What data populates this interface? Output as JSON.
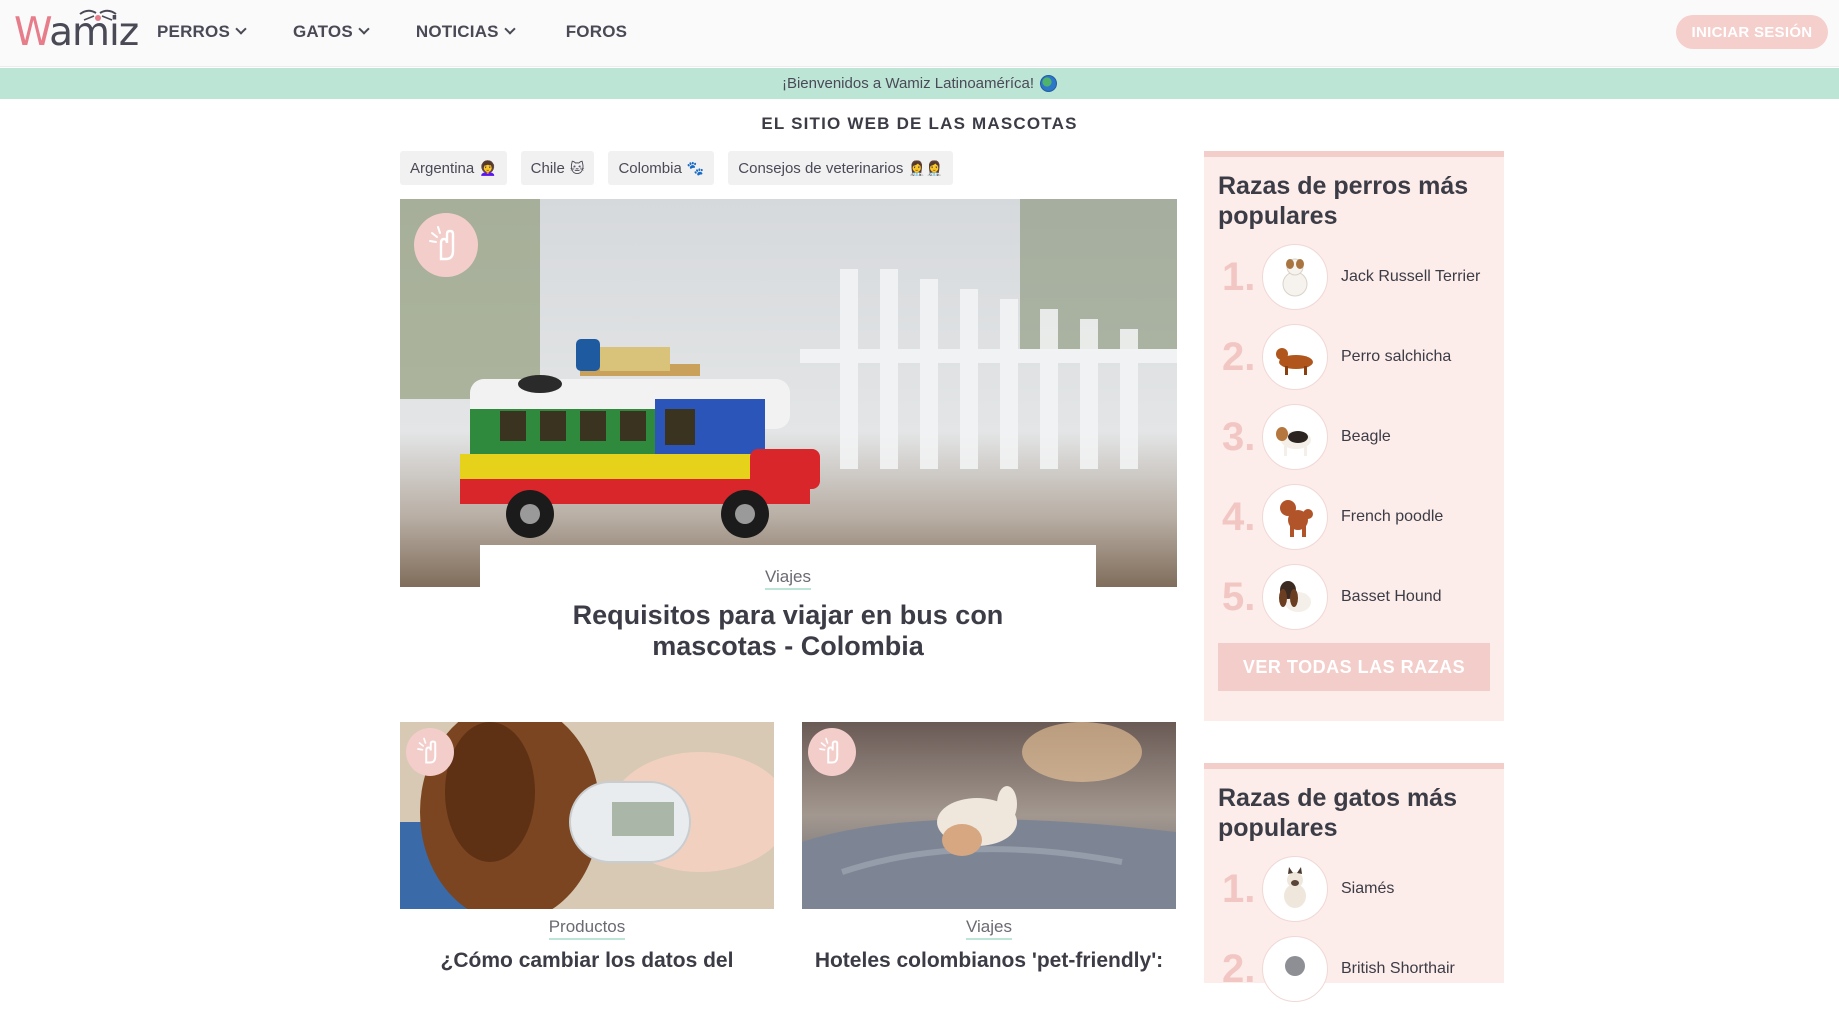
{
  "header": {
    "logo_text_w": "W",
    "logo_text_rest": "amiz",
    "nav": [
      {
        "label": "PERROS",
        "has_dropdown": true
      },
      {
        "label": "GATOS",
        "has_dropdown": true
      },
      {
        "label": "NOTICIAS",
        "has_dropdown": true
      },
      {
        "label": "FOROS",
        "has_dropdown": false
      }
    ],
    "login_label": "INICIAR SESIÓN"
  },
  "welcome_bar": {
    "text": "¡Bienvenidos a Wamiz Latinoaméríca!",
    "icon": "globe-icon"
  },
  "tagline": "EL SITIO WEB DE LAS MASCOTAS",
  "chips": [
    {
      "label": "Argentina",
      "emoji": "👩‍🦱"
    },
    {
      "label": "Chile",
      "emoji": "🐱"
    },
    {
      "label": "Colombia",
      "emoji": "🐾"
    },
    {
      "label": "Consejos de veterinarios",
      "emoji": "👩‍⚕️👩‍⚕️"
    }
  ],
  "hero": {
    "category": "Viajes",
    "title_line1": "Requisitos para viajar en bus con",
    "title_line2": "mascotas - Colombia",
    "badge_icon": "advice-hand-icon"
  },
  "cards": [
    {
      "category": "Productos",
      "title": "¿Cómo cambiar los datos del"
    },
    {
      "category": "Viajes",
      "title": "Hoteles colombianos 'pet-friendly':"
    }
  ],
  "sidebar": {
    "dogs": {
      "title_line1": "Razas de perros más",
      "title_line2": "populares",
      "items": [
        {
          "rank": "1.",
          "name": "Jack Russell Terrier"
        },
        {
          "rank": "2.",
          "name": "Perro salchicha"
        },
        {
          "rank": "3.",
          "name": "Beagle"
        },
        {
          "rank": "4.",
          "name": "French poodle"
        },
        {
          "rank": "5.",
          "name": "Basset Hound"
        }
      ],
      "see_all_label": "VER TODAS LAS RAZAS"
    },
    "cats": {
      "title_line1": "Razas de gatos más",
      "title_line2": "populares",
      "items": [
        {
          "rank": "1.",
          "name": "Siamés"
        },
        {
          "rank": "2.",
          "name": "British Shorthair"
        }
      ]
    }
  },
  "colors": {
    "accent_pink": "#f3cdca",
    "accent_mint": "#bde5d6",
    "text_dark": "#3c3c46",
    "logo_pink": "#e77d8a"
  }
}
